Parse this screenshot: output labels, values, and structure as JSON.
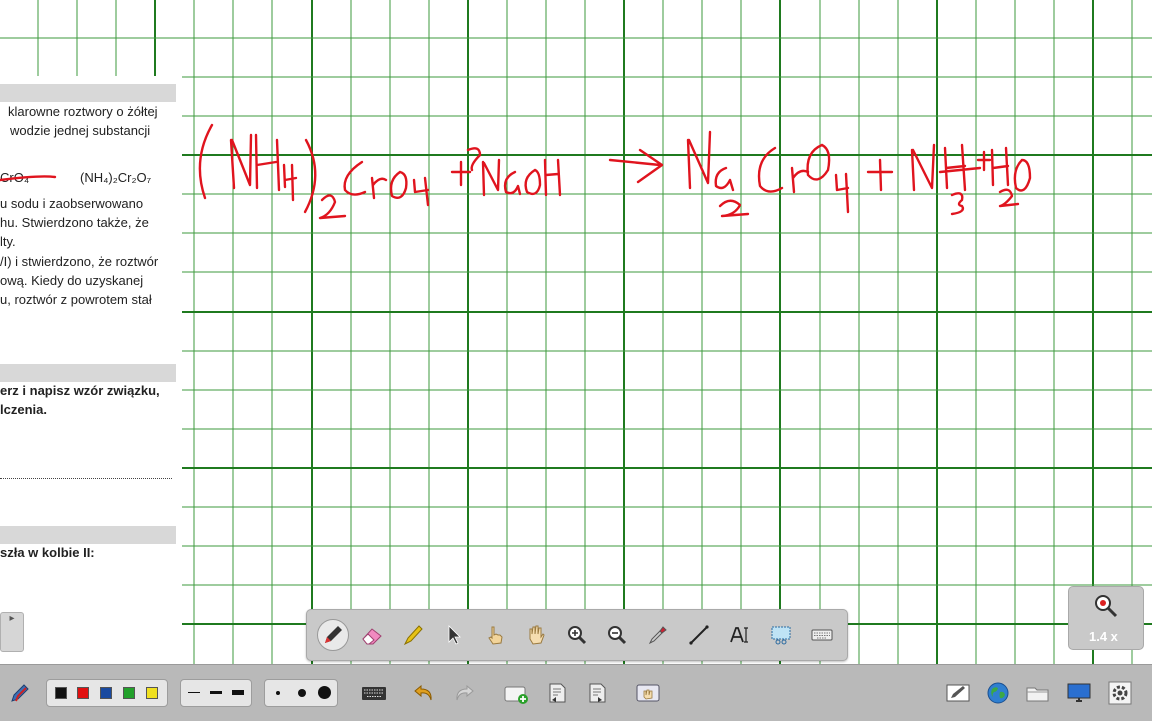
{
  "document": {
    "lines": [
      {
        "text": "klarowne roztwory o żółtej",
        "bold": false
      },
      {
        "text": "wodzie jednej substancji",
        "bold": false
      },
      {
        "text": "CrO₄",
        "bold": false
      },
      {
        "text": "(NH₄)₂Cr₂O₇",
        "bold": false
      },
      {
        "text": "u sodu i zaobserwowano",
        "bold": false
      },
      {
        "text": "hu. Stwierdzono także, że",
        "bold": false
      },
      {
        "text": "lty.",
        "bold": false
      },
      {
        "text": "/I) i stwierdzono, że roztwór",
        "bold": false
      },
      {
        "text": "ową. Kiedy do uzyskanej",
        "bold": false
      },
      {
        "text": "u, roztwór z powrotem stał",
        "bold": false
      },
      {
        "text": "erz i napisz wzór związku,",
        "bold": true
      },
      {
        "text": "lczenia.",
        "bold": true
      },
      {
        "text": "szła w kolbie II:",
        "bold": true
      }
    ]
  },
  "handwriting": {
    "text": "(NH4)2CrO4 + NaOH -> Na2CrO4 + NH3 + H2O",
    "color": "#e0141e"
  },
  "floating_toolbar": {
    "tools": [
      "pen-icon",
      "eraser-icon",
      "highlighter-icon",
      "select-arrow-icon",
      "pointer-hand-icon",
      "pan-hand-icon",
      "zoom-in-icon",
      "zoom-out-icon",
      "color-picker-icon",
      "line-icon",
      "text-tool-icon",
      "screen-capture-icon",
      "keyboard-icon"
    ],
    "active_tool": "pen-icon"
  },
  "zoom": {
    "level": "1.4 x"
  },
  "pager": {
    "arrow": "▸"
  },
  "bottom_toolbar": {
    "colors": [
      "#111111",
      "#e01010",
      "#1a4aa0",
      "#22a02a",
      "#f0e020"
    ],
    "line_widths": [
      "thin",
      "medium",
      "thick"
    ],
    "dot_sizes": [
      "small",
      "medium",
      "large"
    ],
    "right_tools": [
      "pen-settings-icon",
      "globe-icon",
      "folder-icon",
      "display-icon",
      "gear-icon"
    ]
  },
  "colors": {
    "grid_fine": "#3d9a3d",
    "grid_major": "#1f7a1f",
    "toolbar_bg": "#c9c9c9",
    "bottom_bar_bg": "#b9b9b9"
  }
}
